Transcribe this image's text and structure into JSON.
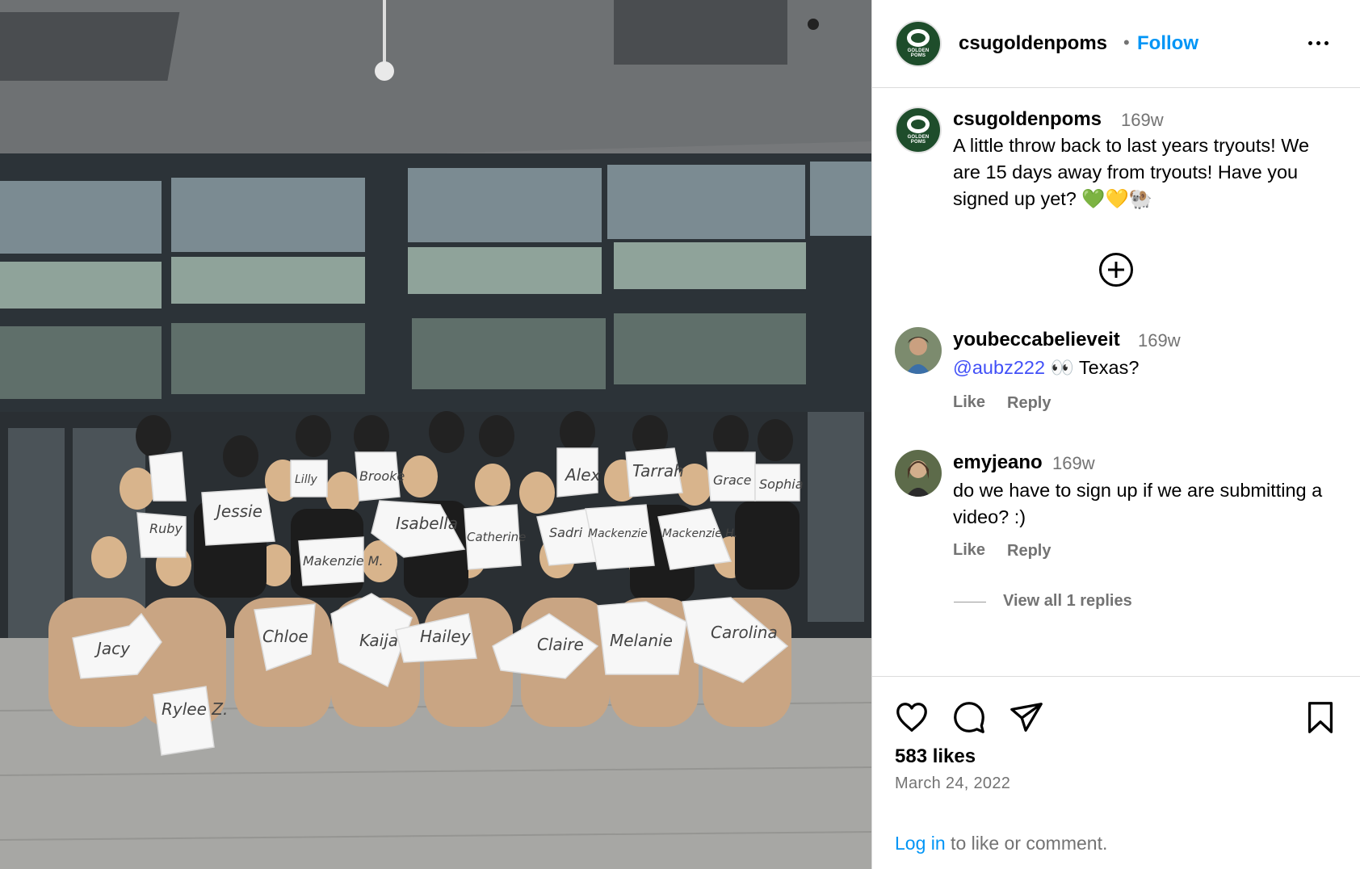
{
  "photo": {
    "description_alt": "",
    "signs": [
      "Jacy",
      "Rylee Z.",
      "Chloe",
      "Kaija",
      "Hailey",
      "Claire",
      "Melanie",
      "Carolina",
      "Makenzie M.",
      "Isabella",
      "Catherine",
      "Sadri",
      "Mackenzie",
      "Mackenzie H.",
      "Jessie",
      "Ruby",
      "Brooke",
      "Lilly",
      "Alex",
      "Tarrah",
      "Grace",
      "Sophia"
    ]
  },
  "header": {
    "username": "csugoldenpoms",
    "separator": "•",
    "follow_label": "Follow",
    "avatar_text": "GOLDEN\nPOMS"
  },
  "caption": {
    "username": "csugoldenpoms",
    "time": "169w",
    "text": "A little throw back to last years tryouts! We are 15 days away from tryouts! Have you signed up yet? 💚💛🐏"
  },
  "comments": [
    {
      "username": "youbeccabelieveit",
      "time": "169w",
      "mention": "@aubz222",
      "text": " 👀 Texas?",
      "like_label": "Like",
      "reply_label": "Reply"
    },
    {
      "username": "emyjeano",
      "time": "169w",
      "text": "do we have to sign up if we are submitting a video? :)",
      "like_label": "Like",
      "reply_label": "Reply"
    }
  ],
  "view_replies_label": "View all 1 replies",
  "footer": {
    "likes": "583 likes",
    "date": "March 24, 2022",
    "login_link": "Log in",
    "login_suffix": " to like or comment."
  },
  "colors": {
    "brand_green": "#1e4d2b",
    "link_blue": "#0095f6",
    "mention_blue": "#4150f7",
    "muted_gray": "#737373",
    "divider": "#dbdbdb"
  },
  "icons": [
    "heart-icon",
    "comment-icon",
    "share-icon",
    "bookmark-icon",
    "more-icon",
    "add-comment-icon"
  ]
}
